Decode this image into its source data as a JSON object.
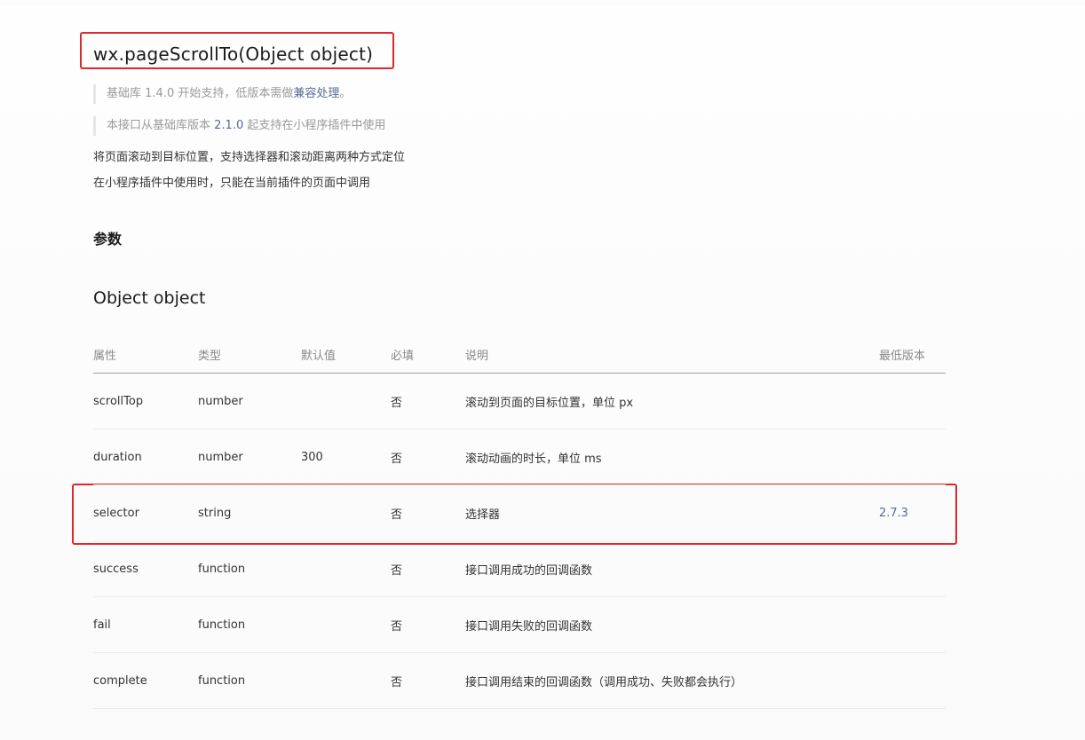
{
  "title": "wx.pageScrollTo(Object object)",
  "notes": [
    {
      "text_before": "基础库 1.4.0 开始支持，低版本需做",
      "link": "兼容处理",
      "text_after": "。"
    },
    {
      "text_before": "本接口从基础库版本 ",
      "link": "2.1.0",
      "text_after": " 起支持在小程序插件中使用"
    }
  ],
  "description": [
    "将页面滚动到目标位置，支持选择器和滚动距离两种方式定位",
    "在小程序插件中使用时，只能在当前插件的页面中调用"
  ],
  "params_heading": "参数",
  "object_heading": "Object object",
  "table": {
    "headers": {
      "prop": "属性",
      "type": "类型",
      "default": "默认值",
      "required": "必填",
      "desc": "说明",
      "version": "最低版本"
    },
    "rows": [
      {
        "prop": "scrollTop",
        "type": "number",
        "default": "",
        "required": "否",
        "desc": "滚动到页面的目标位置，单位 px",
        "version": ""
      },
      {
        "prop": "duration",
        "type": "number",
        "default": "300",
        "required": "否",
        "desc": "滚动动画的时长，单位 ms",
        "version": ""
      },
      {
        "prop": "selector",
        "type": "string",
        "default": "",
        "required": "否",
        "desc": "选择器",
        "version": "2.7.3"
      },
      {
        "prop": "success",
        "type": "function",
        "default": "",
        "required": "否",
        "desc": "接口调用成功的回调函数",
        "version": ""
      },
      {
        "prop": "fail",
        "type": "function",
        "default": "",
        "required": "否",
        "desc": "接口调用失败的回调函数",
        "version": ""
      },
      {
        "prop": "complete",
        "type": "function",
        "default": "",
        "required": "否",
        "desc": "接口调用结束的回调函数（调用成功、失败都会执行）",
        "version": ""
      }
    ]
  },
  "colors": {
    "highlight": "#e0272b",
    "link": "#576b95"
  }
}
